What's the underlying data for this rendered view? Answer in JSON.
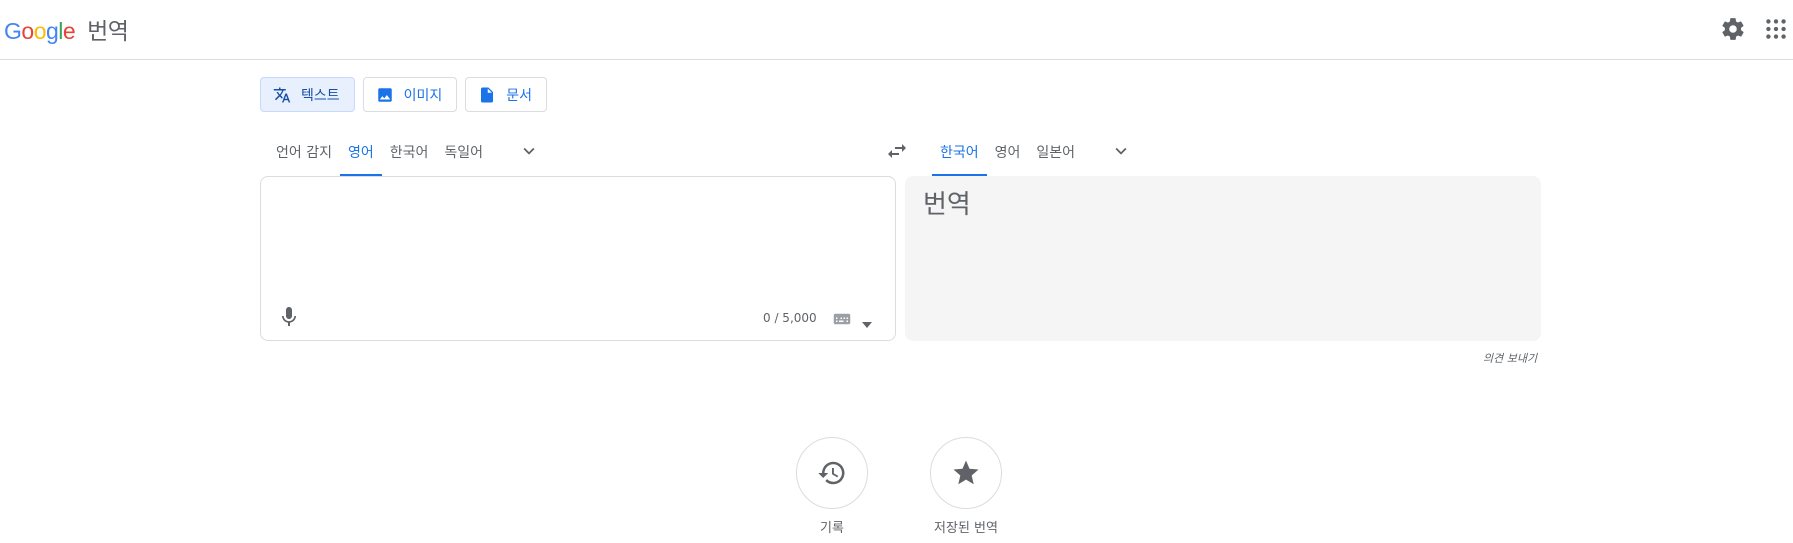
{
  "header": {
    "logo_letters": [
      "G",
      "o",
      "o",
      "g",
      "l",
      "e"
    ],
    "product_name": "번역",
    "settings_icon": "gear-icon",
    "apps_icon": "apps-grid-icon"
  },
  "mode_tabs": [
    {
      "label": "텍스트",
      "icon": "translate-icon",
      "active": true
    },
    {
      "label": "이미지",
      "icon": "image-icon",
      "active": false
    },
    {
      "label": "문서",
      "icon": "document-icon",
      "active": false
    }
  ],
  "source_langs": [
    {
      "label": "언어 감지",
      "active": false
    },
    {
      "label": "영어",
      "active": true
    },
    {
      "label": "한국어",
      "active": false
    },
    {
      "label": "독일어",
      "active": false
    }
  ],
  "target_langs": [
    {
      "label": "한국어",
      "active": true
    },
    {
      "label": "영어",
      "active": false
    },
    {
      "label": "일본어",
      "active": false
    }
  ],
  "source": {
    "value": "",
    "char_count": "0 / 5,000"
  },
  "target": {
    "placeholder": "번역"
  },
  "feedback_link": "의견 보내기",
  "bottom_actions": [
    {
      "label": "기록",
      "icon": "history-icon"
    },
    {
      "label": "저장된 번역",
      "icon": "star-icon"
    }
  ],
  "colors": {
    "accent": "#1a73e8",
    "tab_active_bg": "#e8f0fe",
    "target_bg": "#f5f5f5",
    "border": "#dadce0"
  }
}
